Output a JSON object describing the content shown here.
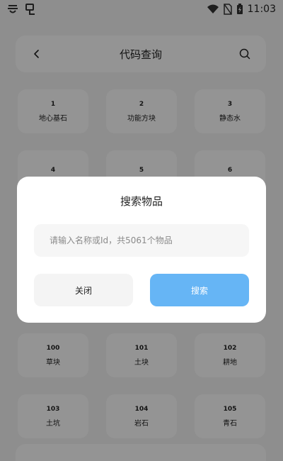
{
  "status_bar": {
    "time": "11:03"
  },
  "header": {
    "title": "代码查询",
    "back_icon": "arrow-left-icon",
    "search_icon": "search-icon"
  },
  "grid_top": [
    {
      "id": "1",
      "name": "地心基石"
    },
    {
      "id": "2",
      "name": "功能方块"
    },
    {
      "id": "3",
      "name": "静态水"
    },
    {
      "id": "4",
      "name": ""
    },
    {
      "id": "5",
      "name": ""
    },
    {
      "id": "6",
      "name": ""
    }
  ],
  "grid_bottom": [
    {
      "id": "100",
      "name": "草块"
    },
    {
      "id": "101",
      "name": "土块"
    },
    {
      "id": "102",
      "name": "耕地"
    },
    {
      "id": "103",
      "name": "土坑"
    },
    {
      "id": "104",
      "name": "岩石"
    },
    {
      "id": "105",
      "name": "青石"
    }
  ],
  "dialog": {
    "title": "搜索物品",
    "input_placeholder": "请输入名称或Id，共5061个物品",
    "input_value": "",
    "close_label": "关闭",
    "search_label": "搜索",
    "accent_color": "#66b5f5"
  }
}
